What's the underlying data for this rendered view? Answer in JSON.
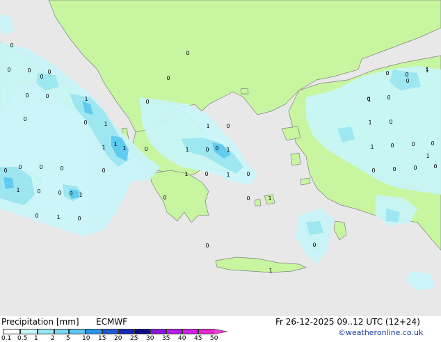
{
  "map": {
    "colors": {
      "sea": "#e8e8e8",
      "land": "#c8f5a0",
      "precip_light": "#c8f5fa",
      "precip_mid": "#9be6f0",
      "precip_heavy": "#5ac8f0",
      "coast": "#808080"
    },
    "value_labels": [
      {
        "text": "0"
      },
      {
        "text": "0"
      },
      {
        "text": "0"
      },
      {
        "text": "0"
      },
      {
        "text": "0"
      },
      {
        "text": "0"
      },
      {
        "text": "0"
      },
      {
        "text": "1"
      },
      {
        "text": "0"
      },
      {
        "text": "1"
      },
      {
        "text": "1"
      },
      {
        "text": "1"
      },
      {
        "text": "1"
      },
      {
        "text": "0"
      },
      {
        "text": "0"
      },
      {
        "text": "0"
      },
      {
        "text": "0"
      },
      {
        "text": "0"
      },
      {
        "text": "0"
      },
      {
        "text": "1"
      },
      {
        "text": "0"
      },
      {
        "text": "0"
      },
      {
        "text": "0"
      },
      {
        "text": "1"
      },
      {
        "text": "0"
      },
      {
        "text": "1"
      },
      {
        "text": "0"
      },
      {
        "text": "1"
      },
      {
        "text": "0"
      },
      {
        "text": "0"
      },
      {
        "text": "0"
      },
      {
        "text": "1"
      },
      {
        "text": "0"
      },
      {
        "text": "0"
      },
      {
        "text": "1"
      },
      {
        "text": "1"
      },
      {
        "text": "0"
      },
      {
        "text": "0"
      },
      {
        "text": "0"
      },
      {
        "text": "1"
      },
      {
        "text": "0"
      },
      {
        "text": "1"
      },
      {
        "text": "0"
      },
      {
        "text": "0"
      },
      {
        "text": "0"
      },
      {
        "text": "0"
      },
      {
        "text": "0"
      },
      {
        "text": "1"
      },
      {
        "text": "0"
      },
      {
        "text": "0"
      },
      {
        "text": "1"
      },
      {
        "text": "0"
      },
      {
        "text": "1"
      },
      {
        "text": "0"
      },
      {
        "text": "0"
      },
      {
        "text": "1"
      },
      {
        "text": "0"
      },
      {
        "text": "0"
      },
      {
        "text": "0"
      },
      {
        "text": "1"
      },
      {
        "text": "0"
      },
      {
        "text": "0"
      },
      {
        "text": "1"
      },
      {
        "text": "0"
      },
      {
        "text": "1"
      },
      {
        "text": "0"
      }
    ]
  },
  "footer": {
    "title": "Precipitation [mm]",
    "model": "ECMWF",
    "valid_time": "Fr 26-12-2025 09..12 UTC (12+24)",
    "credit": "©weatheronline.co.uk"
  },
  "legend": {
    "ticks": [
      "0.1",
      "0.5",
      "1",
      "2",
      "5",
      "10",
      "15",
      "20",
      "25",
      "30",
      "35",
      "40",
      "45",
      "50"
    ],
    "colors": [
      "#ffffff",
      "#c8f5fa",
      "#9be6f0",
      "#78d7f5",
      "#5ac8f0",
      "#2896e6",
      "#1e5ad2",
      "#1428b4",
      "#0a0a82",
      "#8c14dc",
      "#b41ee6",
      "#d21ee6",
      "#e628d2",
      "#f03cd2"
    ]
  }
}
